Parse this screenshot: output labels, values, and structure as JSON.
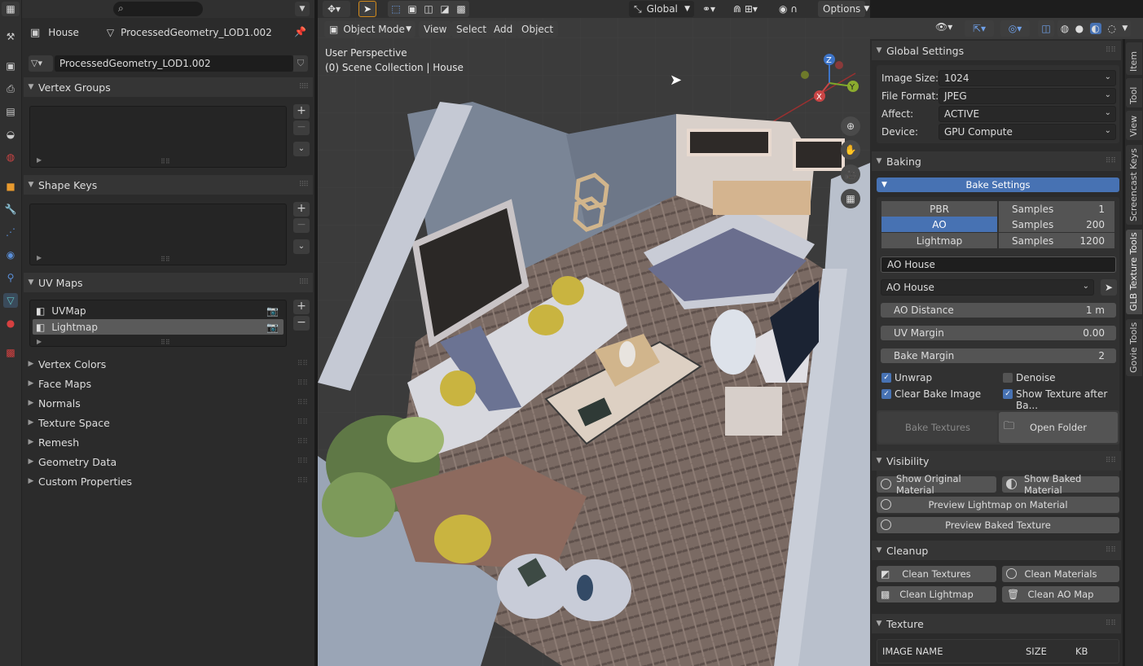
{
  "properties": {
    "object_name": "House",
    "mesh_name": "ProcessedGeometry_LOD1.002",
    "data_name": "ProcessedGeometry_LOD1.002",
    "panels": {
      "vertex_groups": "Vertex Groups",
      "shape_keys": "Shape Keys",
      "uv_maps": "UV Maps"
    },
    "uv_maps": [
      "UVMap",
      "Lightmap"
    ],
    "collapsed": [
      "Vertex Colors",
      "Face Maps",
      "Normals",
      "Texture Space",
      "Remesh",
      "Geometry Data",
      "Custom Properties"
    ]
  },
  "viewport": {
    "transform_orientation": "Global",
    "mode": "Object Mode",
    "menus": [
      "View",
      "Select",
      "Add",
      "Object"
    ],
    "options_label": "Options",
    "info_line1": "User Perspective",
    "info_line2": "(0) Scene Collection | House",
    "gizmo": {
      "z": "Z",
      "y": "Y",
      "x": "X"
    }
  },
  "sidebar": {
    "tabs": [
      "Item",
      "Tool",
      "View",
      "Screencast Keys",
      "GLB Texture Tools",
      "Govie Tools"
    ],
    "global_settings": {
      "title": "Global Settings",
      "image_size_label": "Image Size:",
      "image_size": "1024",
      "file_format_label": "File Format:",
      "file_format": "JPEG",
      "affect_label": "Affect:",
      "affect": "ACTIVE",
      "device_label": "Device:",
      "device": "GPU Compute"
    },
    "baking": {
      "title": "Baking",
      "bake_settings": "Bake Settings",
      "rows": [
        {
          "name": "PBR",
          "samples_label": "Samples",
          "samples": "1",
          "active": false
        },
        {
          "name": "AO",
          "samples_label": "Samples",
          "samples": "200",
          "active": true
        },
        {
          "name": "Lightmap",
          "samples_label": "Samples",
          "samples": "1200",
          "active": false
        }
      ],
      "name_field": "AO House",
      "target_select": "AO House",
      "ao_distance_label": "AO Distance",
      "ao_distance": "1 m",
      "uv_margin_label": "UV Margin",
      "uv_margin": "0.00",
      "bake_margin_label": "Bake Margin",
      "bake_margin": "2",
      "unwrap": "Unwrap",
      "denoise": "Denoise",
      "clear_bake_image": "Clear Bake Image",
      "show_texture_after": "Show Texture after Ba...",
      "bake_textures": "Bake Textures",
      "open_folder": "Open Folder"
    },
    "visibility": {
      "title": "Visibility",
      "show_original": "Show Original Material",
      "show_baked": "Show Baked Material",
      "preview_lightmap": "Preview Lightmap on Material",
      "preview_baked": "Preview Baked Texture"
    },
    "cleanup": {
      "title": "Cleanup",
      "clean_textures": "Clean Textures",
      "clean_materials": "Clean Materials",
      "clean_lightmap": "Clean Lightmap",
      "clean_ao_map": "Clean AO Map"
    },
    "texture": {
      "title": "Texture",
      "col_name": "IMAGE NAME",
      "col_size": "SIZE",
      "col_kb": "KB"
    }
  },
  "colors": {
    "accent": "#4772b3",
    "panel": "#2b2b2b",
    "header": "#303030"
  }
}
